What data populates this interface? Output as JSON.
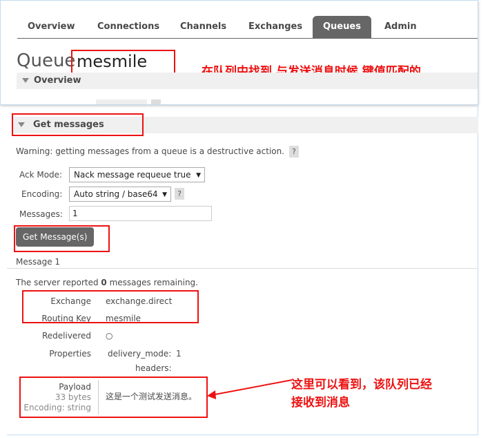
{
  "nav": {
    "tabs": [
      {
        "label": "Overview"
      },
      {
        "label": "Connections"
      },
      {
        "label": "Channels"
      },
      {
        "label": "Exchanges"
      },
      {
        "label": "Queues",
        "active": true
      },
      {
        "label": "Admin"
      }
    ]
  },
  "queue": {
    "title_prefix": "Queue",
    "name": "mesmile"
  },
  "annotations": {
    "top": "在队列中找到 与发送消息时候 键值匹配的",
    "bottom_line1": "这里可以看到，该队列已经",
    "bottom_line2": "接收到消息"
  },
  "sections": {
    "overview": "Overview",
    "get_messages": "Get messages"
  },
  "get_messages": {
    "warning": "Warning: getting messages from a queue is a destructive action.",
    "help": "?",
    "ack_mode_label": "Ack Mode:",
    "ack_mode_value": "Nack message requeue true",
    "encoding_label": "Encoding:",
    "encoding_value": "Auto string / base64",
    "messages_label": "Messages:",
    "messages_value": "1",
    "button": "Get Message(s)"
  },
  "message": {
    "heading": "Message 1",
    "server_report_prefix": "The server reported ",
    "server_report_count": "0",
    "server_report_suffix": " messages remaining.",
    "exchange_label": "Exchange",
    "exchange_value": "exchange.direct",
    "routing_key_label": "Routing Key",
    "routing_key_value": "mesmile",
    "redelivered_label": "Redelivered",
    "redelivered_value": "○",
    "properties_label": "Properties",
    "delivery_mode_label": "delivery_mode:",
    "delivery_mode_value": "1",
    "headers_label": "headers:",
    "payload_label": "Payload",
    "payload_size": "33 bytes",
    "payload_encoding": "Encoding: string",
    "payload_value": "这是一个测试发送消息。"
  },
  "colors": {
    "accent": "#666666",
    "annotation": "#ee1111"
  }
}
